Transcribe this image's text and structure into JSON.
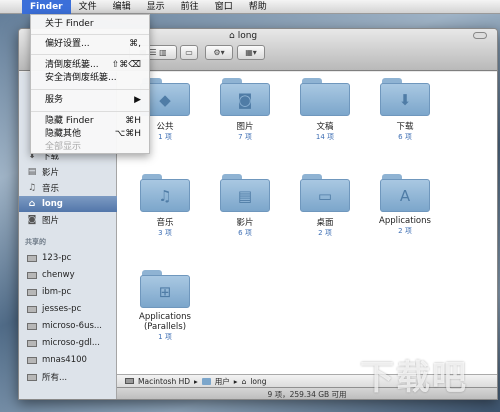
{
  "menubar": {
    "items": [
      "Finder",
      "文件",
      "编辑",
      "显示",
      "前往",
      "窗口",
      "帮助"
    ]
  },
  "dropdown": {
    "items": [
      {
        "label": "关于 Finder",
        "shortcut": ""
      },
      {
        "label": "偏好设置...",
        "shortcut": "⌘,"
      },
      {
        "label": "清倒废纸篓...",
        "shortcut": "⇧⌘⌫"
      },
      {
        "label": "安全清倒废纸篓...",
        "shortcut": ""
      },
      {
        "label": "服务",
        "shortcut": "▶"
      },
      {
        "label": "隐藏 Finder",
        "shortcut": "⌘H"
      },
      {
        "label": "隐藏其他",
        "shortcut": "⌥⌘H"
      },
      {
        "label": "全部显示",
        "shortcut": ""
      }
    ]
  },
  "window": {
    "title": "long"
  },
  "sidebar": {
    "items": [
      {
        "label": "下载",
        "icon": "download-icon"
      },
      {
        "label": "影片",
        "icon": "film-icon"
      },
      {
        "label": "音乐",
        "icon": "music-icon"
      },
      {
        "label": "long",
        "icon": "home-icon"
      },
      {
        "label": "图片",
        "icon": "camera-icon"
      }
    ],
    "shared_header": "共享的",
    "shared": [
      "123-pc",
      "chenwy",
      "ibm-pc",
      "jesses-pc",
      "microso-6us...",
      "microso-gdl...",
      "mnas4100",
      "所有..."
    ]
  },
  "folders": [
    {
      "name": "公共",
      "count": "1 项",
      "icon": "sign-icon"
    },
    {
      "name": "图片",
      "count": "7 项",
      "icon": "camera-icon"
    },
    {
      "name": "文稿",
      "count": "14 项",
      "icon": "document-icon"
    },
    {
      "name": "下载",
      "count": "6 项",
      "icon": "download-icon"
    },
    {
      "name": "音乐",
      "count": "3 项",
      "icon": "music-icon"
    },
    {
      "name": "影片",
      "count": "6 项",
      "icon": "film-icon"
    },
    {
      "name": "桌面",
      "count": "2 项",
      "icon": "desktop-icon"
    },
    {
      "name": "Applications",
      "count": "2 项",
      "icon": "app-icon"
    },
    {
      "name": "Applications (Parallels)",
      "count": "1 项",
      "icon": "windows-icon"
    }
  ],
  "pathbar": [
    "Macintosh HD",
    "用户",
    "long"
  ],
  "statusbar": {
    "text": "9 项，259.34 GB 可用"
  }
}
